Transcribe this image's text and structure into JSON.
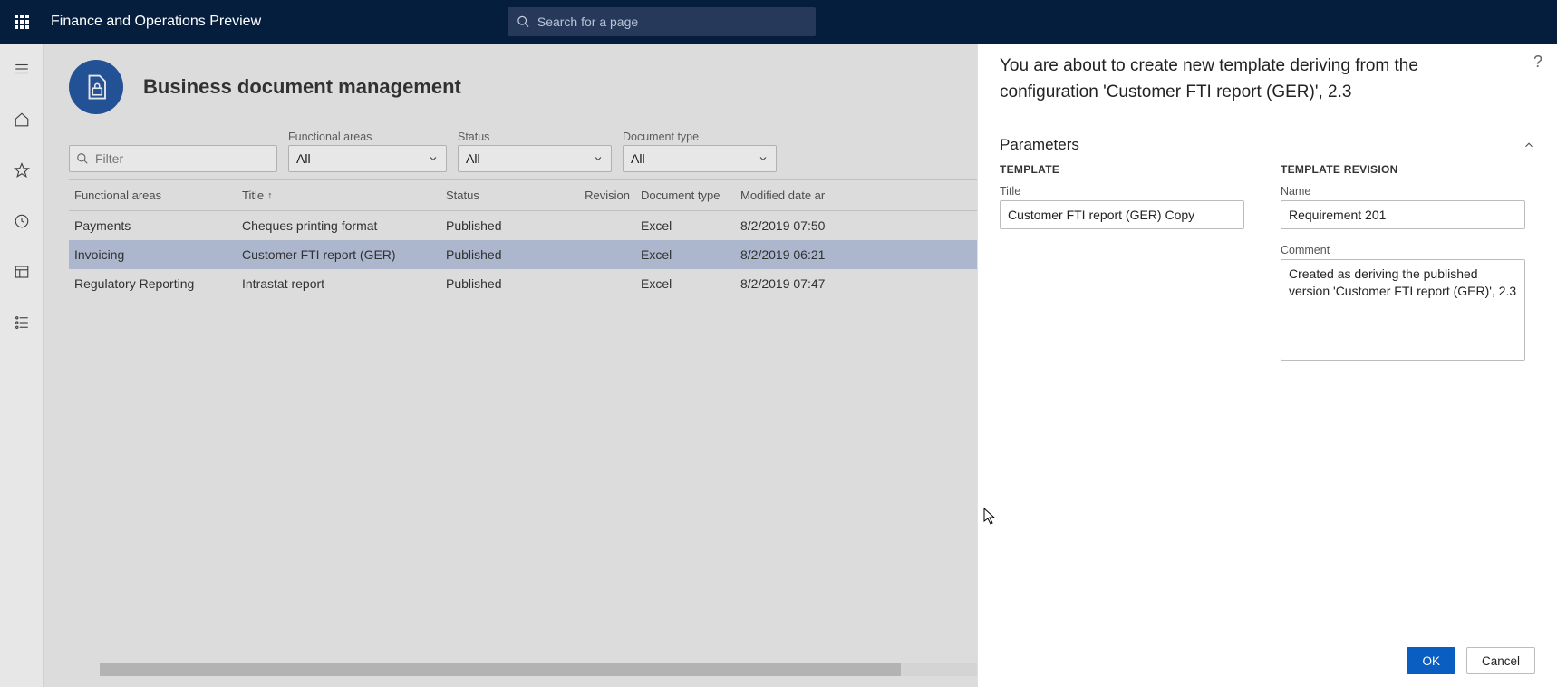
{
  "topbar": {
    "app_title": "Finance and Operations Preview",
    "search_placeholder": "Search for a page"
  },
  "page": {
    "title": "Business document management"
  },
  "filters": {
    "filter_placeholder": "Filter",
    "functional_areas": {
      "label": "Functional areas",
      "value": "All"
    },
    "status": {
      "label": "Status",
      "value": "All"
    },
    "document_type": {
      "label": "Document type",
      "value": "All"
    }
  },
  "table": {
    "columns": {
      "functional_areas": "Functional areas",
      "title": "Title",
      "status": "Status",
      "revision": "Revision",
      "document_type": "Document type",
      "modified": "Modified date ar"
    },
    "rows": [
      {
        "functional_areas": "Payments",
        "title": "Cheques printing format",
        "status": "Published",
        "revision": "",
        "document_type": "Excel",
        "modified": "8/2/2019 07:50"
      },
      {
        "functional_areas": "Invoicing",
        "title": "Customer FTI report (GER)",
        "status": "Published",
        "revision": "",
        "document_type": "Excel",
        "modified": "8/2/2019 06:21"
      },
      {
        "functional_areas": "Regulatory Reporting",
        "title": "Intrastat report",
        "status": "Published",
        "revision": "",
        "document_type": "Excel",
        "modified": "8/2/2019 07:47"
      }
    ],
    "selected_index": 1
  },
  "panel": {
    "headline": "You are about to create new template deriving from the configuration 'Customer FTI report (GER)', 2.3",
    "section_title": "Parameters",
    "template": {
      "heading": "TEMPLATE",
      "title_label": "Title",
      "title_value": "Customer FTI report (GER) Copy"
    },
    "revision": {
      "heading": "TEMPLATE REVISION",
      "name_label": "Name",
      "name_value": "Requirement 201",
      "comment_label": "Comment",
      "comment_value": "Created as deriving the published version 'Customer FTI report (GER)', 2.3"
    },
    "ok": "OK",
    "cancel": "Cancel",
    "help": "?"
  }
}
